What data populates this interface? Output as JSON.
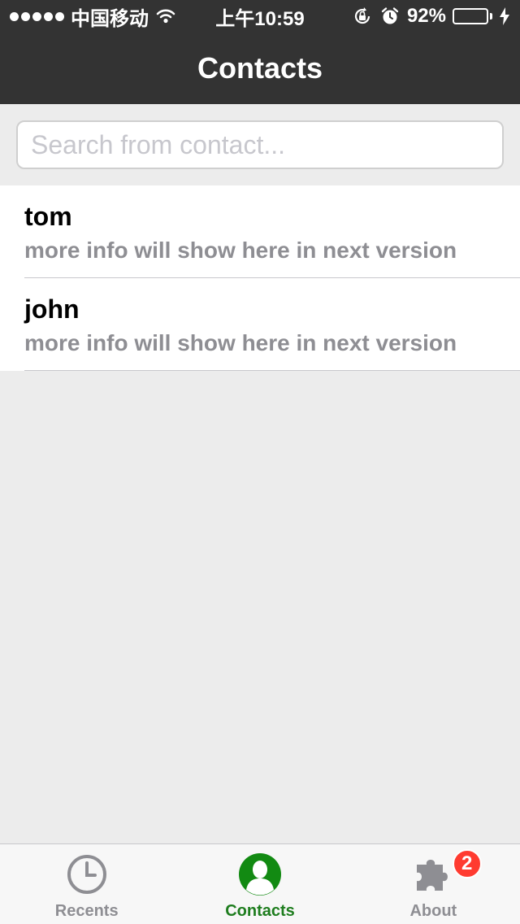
{
  "status_bar": {
    "carrier": "中国移动",
    "time": "上午10:59",
    "battery_percent": "92%",
    "battery_level": 0.92,
    "icons": [
      "signal-dots-icon",
      "wifi-icon",
      "orientation-lock-icon",
      "alarm-icon",
      "battery-icon",
      "charging-icon"
    ]
  },
  "nav": {
    "title": "Contacts"
  },
  "search": {
    "placeholder": "Search from contact...",
    "value": ""
  },
  "contacts": [
    {
      "name": "tom",
      "info": "more info will show here in next version"
    },
    {
      "name": "john",
      "info": "more info will show here in next version"
    }
  ],
  "tab_bar": {
    "tabs": [
      {
        "label": "Recents",
        "icon": "clock-icon",
        "active": false
      },
      {
        "label": "Contacts",
        "icon": "person-icon",
        "active": true
      },
      {
        "label": "About",
        "icon": "puzzle-icon",
        "active": false,
        "badge": "2"
      }
    ]
  },
  "colors": {
    "bar_background": "#333333",
    "accent_green": "#1e7d1e",
    "badge_red": "#ff3b30",
    "battery_green": "#4cd964"
  }
}
